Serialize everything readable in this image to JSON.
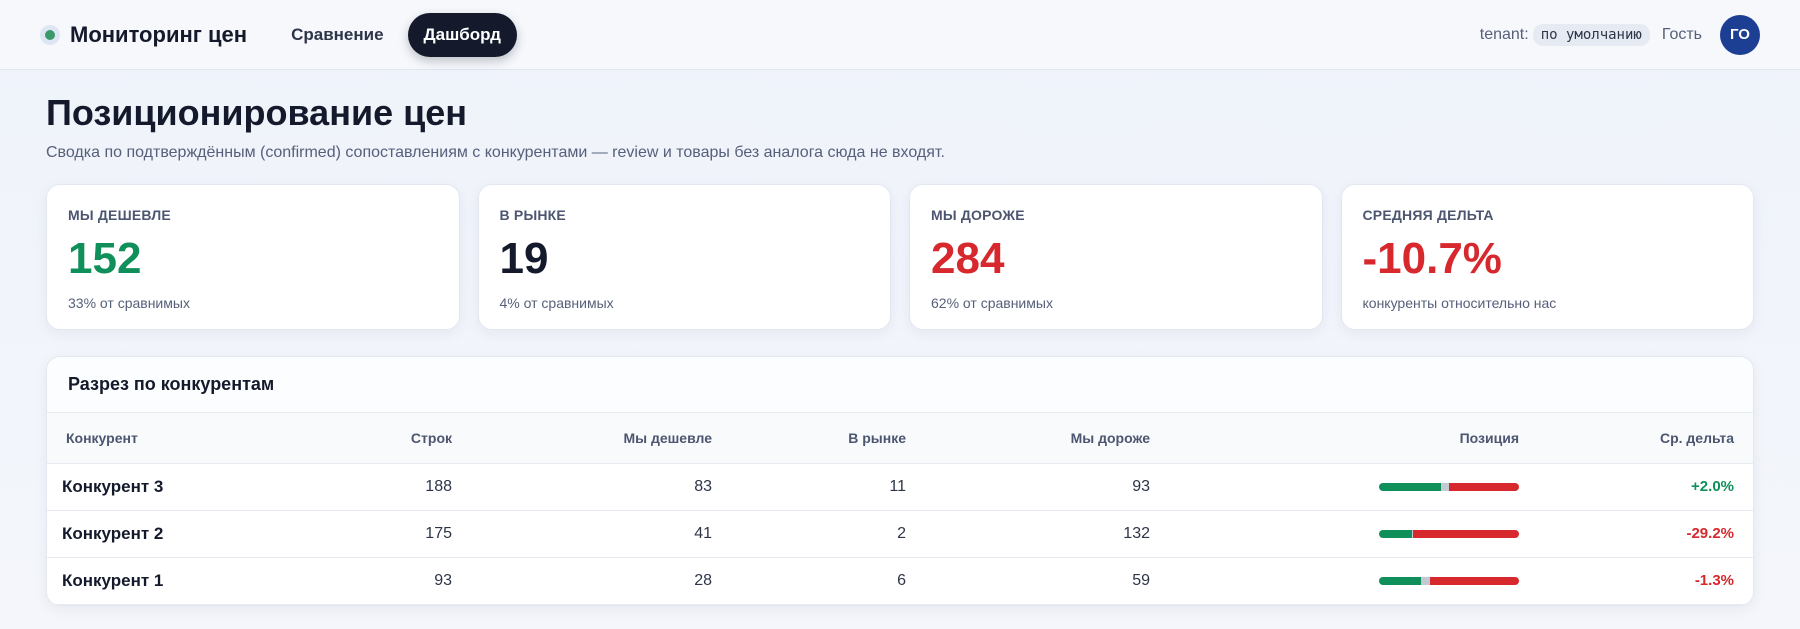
{
  "header": {
    "app_title": "Мониторинг цен",
    "nav": [
      {
        "label": "Сравнение",
        "active": false
      },
      {
        "label": "Дашборд",
        "active": true
      }
    ],
    "tenant_label": "tenant:",
    "tenant_value": "по умолчанию",
    "user_name": "Гость",
    "avatar_initials": "ГО"
  },
  "page": {
    "title": "Позиционирование цен",
    "subtitle": "Сводка по подтверждённым (confirmed) сопоставлениям с конкурентами — review и товары без аналога сюда не входят."
  },
  "cards": [
    {
      "label": "МЫ ДЕШЕВЛЕ",
      "value": "152",
      "note": "33% от сравнимых",
      "color": "#0f8f5a"
    },
    {
      "label": "В РЫНКЕ",
      "value": "19",
      "note": "4% от сравнимых",
      "color": "#141a2b"
    },
    {
      "label": "МЫ ДОРОЖЕ",
      "value": "284",
      "note": "62% от сравнимых",
      "color": "#d6282d"
    },
    {
      "label": "СРЕДНЯЯ ДЕЛЬТА",
      "value": "-10.7%",
      "note": "конкуренты относительно нас",
      "color": "#d6282d"
    }
  ],
  "competitors": {
    "title": "Разрез по конкурентам",
    "columns": {
      "name": "Конкурент",
      "rows": "Строк",
      "cheaper": "Мы дешевле",
      "market": "В рынке",
      "higher": "Мы дороже",
      "position": "Позиция",
      "delta": "Ср. дельта"
    },
    "rows": [
      {
        "name": "Конкурент 3",
        "rows": "188",
        "cheaper": "83",
        "market": "11",
        "higher": "93",
        "delta": "+2.0%",
        "delta_color": "#0f8f5a"
      },
      {
        "name": "Конкурент 2",
        "rows": "175",
        "cheaper": "41",
        "market": "2",
        "higher": "132",
        "delta": "-29.2%",
        "delta_color": "#d6282d"
      },
      {
        "name": "Конкурент 1",
        "rows": "93",
        "cheaper": "28",
        "market": "6",
        "higher": "59",
        "delta": "-1.3%",
        "delta_color": "#d6282d"
      }
    ]
  }
}
